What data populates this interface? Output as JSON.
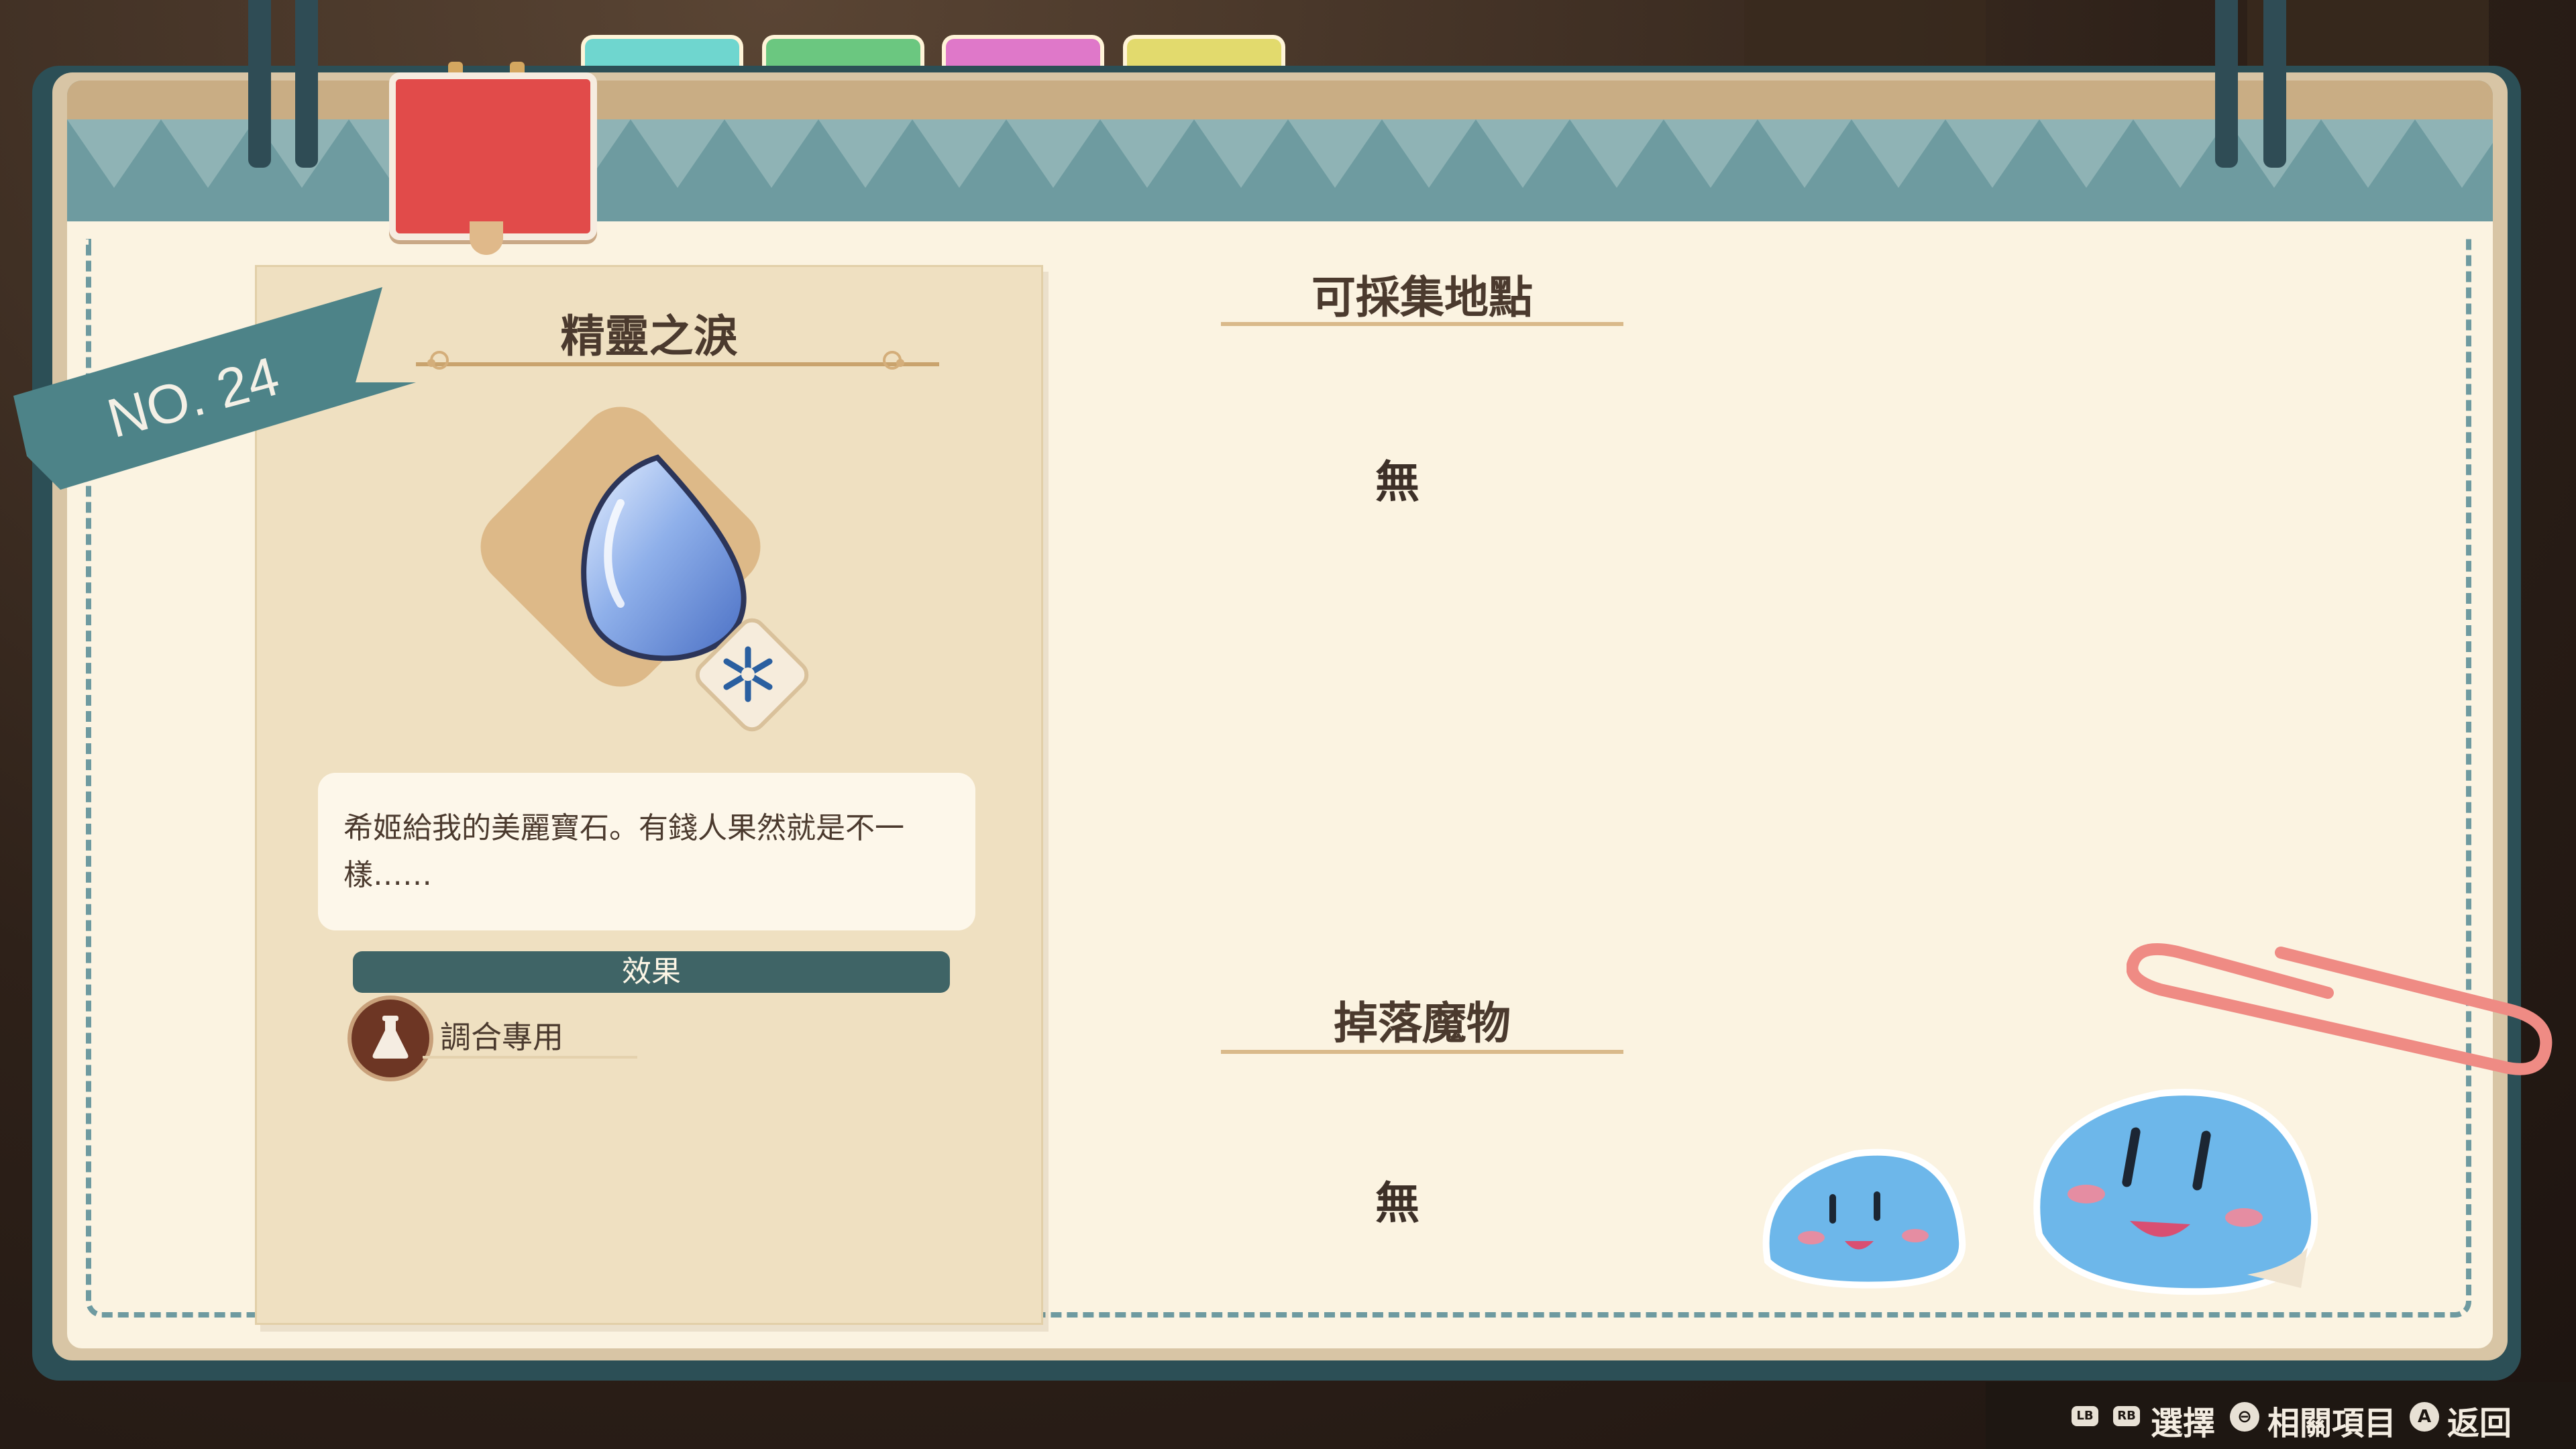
{
  "item": {
    "number": "NO. 24",
    "name": "精靈之淚",
    "description": "希姬給我的美麗寶石。有錢人果然就是不一樣……",
    "element_icon": "snowflake-icon",
    "item_icon": "water-drop-gem-icon"
  },
  "effect": {
    "header": "效果",
    "icon": "flask-icon",
    "text": "調合專用"
  },
  "gather": {
    "title": "可採集地點",
    "value": "無"
  },
  "drops": {
    "title": "掉落魔物",
    "value": "無"
  },
  "tabs": [
    {
      "color": "#6fd6cf"
    },
    {
      "color": "#6bc780"
    },
    {
      "color": "#df78c9"
    },
    {
      "color": "#e2da6d"
    }
  ],
  "active_tab_color": "#e14b4a",
  "footer": {
    "lb": "LB",
    "rb": "RB",
    "select": "選擇",
    "related_button": "⊖",
    "related": "相關項目",
    "a_button": "A",
    "back": "返回"
  }
}
